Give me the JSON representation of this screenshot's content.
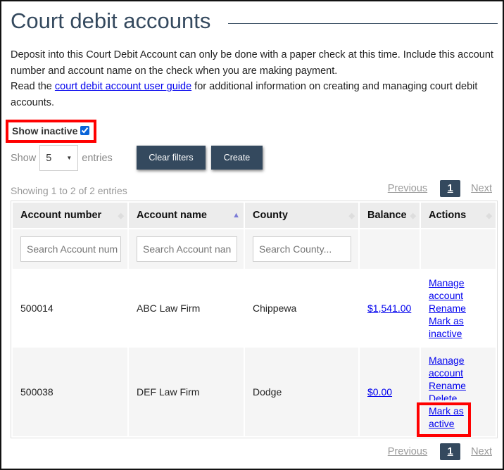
{
  "title": "Court debit accounts",
  "intro": {
    "p1": "Deposit into this Court Debit Account can only be done with a paper check at this time. Include this account number and account name on the check when you are making payment.",
    "p2_before": "Read the ",
    "p2_link": "court debit account user guide",
    "p2_after": " for additional information on creating and managing court debit accounts."
  },
  "show_inactive": {
    "label": "Show inactive",
    "checked": true
  },
  "length": {
    "show": "Show",
    "value": "5",
    "entries": "entries"
  },
  "buttons": {
    "clear": "Clear filters",
    "create": "Create"
  },
  "info": "Showing 1 to 2 of 2 entries",
  "pager": {
    "prev": "Previous",
    "page": "1",
    "next": "Next"
  },
  "columns": [
    "Account number",
    "Account name",
    "County",
    "Balance",
    "Actions"
  ],
  "filters": {
    "account_number": "Search Account num",
    "account_name": "Search Account nan",
    "county": "Search County..."
  },
  "rows": [
    {
      "number": "500014",
      "name": "ABC Law Firm",
      "county": "Chippewa",
      "balance": "$1,541.00",
      "actions": [
        "Manage account",
        "Rename",
        "Mark as inactive"
      ]
    },
    {
      "number": "500038",
      "name": "DEF Law Firm",
      "county": "Dodge",
      "balance": "$0.00",
      "actions": [
        "Manage account",
        "Rename",
        "Delete",
        "Mark as active"
      ]
    }
  ],
  "colors": {
    "primary": "#34495e",
    "highlight": "#ff0000",
    "link": "#0000ee"
  }
}
